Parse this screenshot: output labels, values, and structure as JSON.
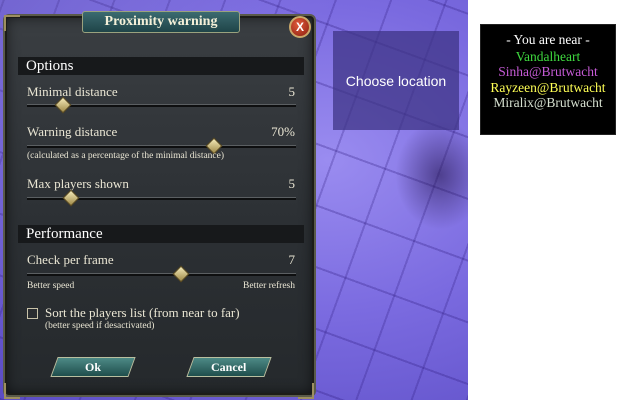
{
  "dialog": {
    "title": "Proximity warning",
    "close_glyph": "X",
    "options_heading": "Options",
    "minimal_distance": {
      "label": "Minimal distance",
      "value": "5",
      "level": 0.13
    },
    "warning_distance": {
      "label": "Warning distance",
      "value": "70%",
      "level": 0.69,
      "note": "(calculated as a percentage of the minimal distance)"
    },
    "max_players": {
      "label": "Max players shown",
      "value": "5",
      "level": 0.16
    },
    "performance_heading": "Performance",
    "check_per_frame": {
      "label": "Check per frame",
      "value": "7",
      "level": 0.57,
      "left_caption": "Better speed",
      "right_caption": "Better refresh"
    },
    "sort_players": {
      "label": "Sort the players list (from near to far)",
      "note": "(better speed if desactivated)",
      "checked": false
    },
    "ok_label": "Ok",
    "cancel_label": "Cancel"
  },
  "choose_location": "Choose location",
  "near_box": {
    "header": "- You are near -",
    "players": [
      {
        "name": "Vandalheart",
        "color": "#3fd93f"
      },
      {
        "name": "Sinha@Brutwacht",
        "color": "#c65bd6"
      },
      {
        "name": "Rayzeen@Brutwacht",
        "color": "#ffff55"
      },
      {
        "name": "Miralix@Brutwacht",
        "color": "#d6e0d0"
      }
    ]
  },
  "icons": {
    "close": "close-icon",
    "checkbox": "checkbox-icon",
    "slider_thumb": "diamond-thumb-icon"
  }
}
